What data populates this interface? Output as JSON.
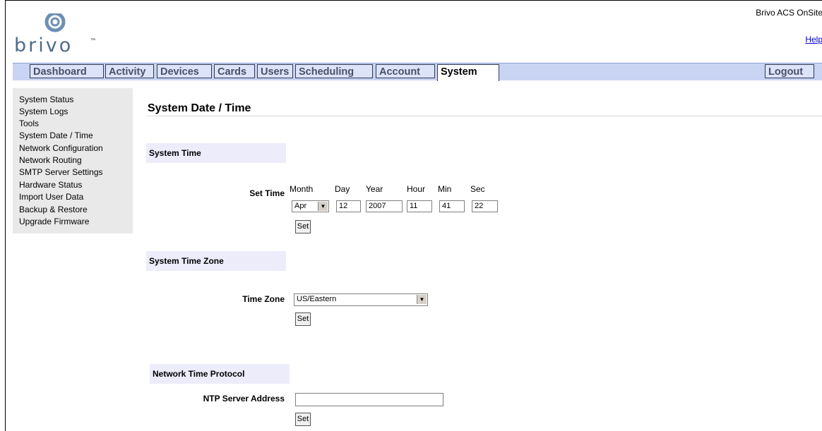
{
  "header": {
    "logo_text": "brivo",
    "logo_tm": "™",
    "product_name": "Brivo ACS OnSite",
    "help_label": "Help"
  },
  "nav": {
    "tabs": [
      "Dashboard",
      "Activity",
      "Devices",
      "Cards",
      "Users",
      "Scheduling",
      "Account",
      "System"
    ],
    "active_tab": "System",
    "logout_label": "Logout"
  },
  "sidebar": {
    "items": [
      "System Status",
      "System Logs",
      "Tools",
      "System Date / Time",
      "Network Configuration",
      "Network Routing",
      "SMTP Server Settings",
      "Hardware Status",
      "Import User Data",
      "Backup & Restore",
      "Upgrade Firmware"
    ]
  },
  "main": {
    "title": "System Date / Time",
    "system_time": {
      "heading": "System Time",
      "set_time_label": "Set Time",
      "columns": [
        "Month",
        "Day",
        "Year",
        "Hour",
        "Min",
        "Sec"
      ],
      "month": "Apr",
      "day": "12",
      "year": "2007",
      "hour": "11",
      "min": "41",
      "sec": "22",
      "set_button": "Set"
    },
    "time_zone": {
      "heading": "System Time Zone",
      "label": "Time Zone",
      "value": "US/Eastern",
      "set_button": "Set"
    },
    "ntp": {
      "heading": "Network Time Protocol",
      "label": "NTP Server Address",
      "value": "",
      "set_button": "Set"
    }
  },
  "colors": {
    "nav_bar": "#c9d4f2",
    "tab_bg": "#dde4fa",
    "section_bg": "#ececfb",
    "sidebar_bg": "#e9e9e9",
    "logo": "#4d6b8c",
    "link": "#0000cc"
  },
  "icons": {
    "logo": "brivo-swirl-icon",
    "dropdown": "triangle-down-icon"
  }
}
